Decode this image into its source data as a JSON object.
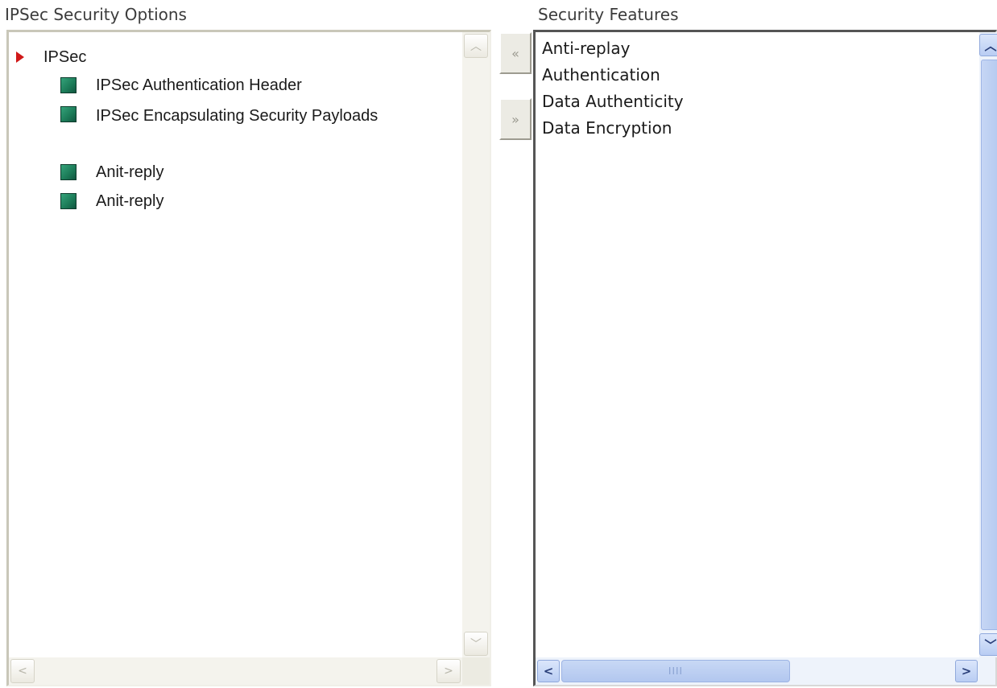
{
  "left_panel": {
    "title": "IPSec Security Options",
    "root": {
      "label": "IPSec",
      "icon": "arrow-right-icon"
    },
    "children": [
      {
        "label": "IPSec Authentication Header",
        "icon": "green-square-icon"
      },
      {
        "label": "IPSec Encapsulating Security Payloads",
        "icon": "green-square-icon"
      },
      {
        "label": "Anit-reply",
        "icon": "green-square-icon"
      },
      {
        "label": "Anit-reply",
        "icon": "green-square-icon"
      }
    ]
  },
  "transfer_buttons": {
    "move_left_glyph": "«",
    "move_right_glyph": "»"
  },
  "right_panel": {
    "title": "Security Features",
    "items": [
      "Anti-replay",
      "Authentication",
      "Data Authenticity",
      "Data Encryption"
    ],
    "hscroll_grip": "IIII"
  },
  "scroll_glyphs": {
    "up": "︿",
    "down": "﹀",
    "left": "<",
    "right": ">"
  },
  "colors": {
    "accent_red": "#d01818",
    "leaf_green": "#1b7a57",
    "scroll_blue": "#b4c9f0"
  }
}
